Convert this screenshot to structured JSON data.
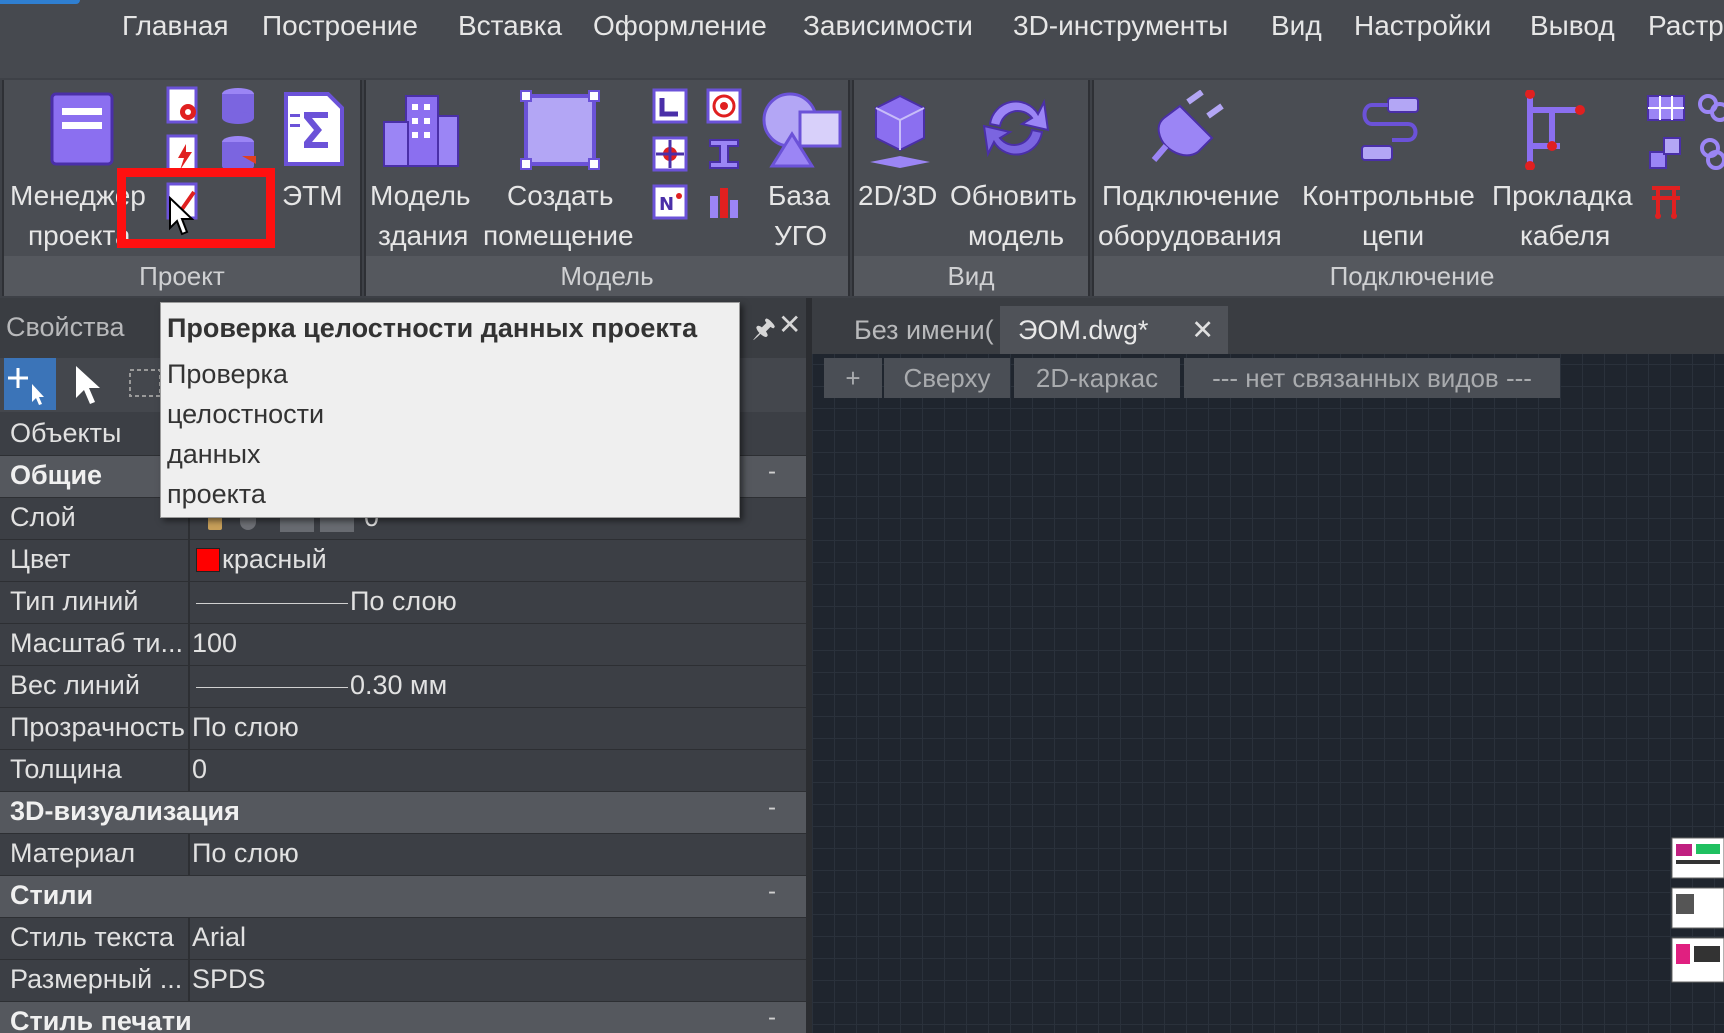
{
  "menu": {
    "items": [
      "Главная",
      "Построение",
      "Вставка",
      "Оформление",
      "Зависимости",
      "3D-инструменты",
      "Вид",
      "Настройки",
      "Вывод",
      "Растр"
    ]
  },
  "ribbon": {
    "panels": {
      "project": "Проект",
      "model": "Модель",
      "view": "Вид",
      "connection": "Подключение"
    },
    "buttons": {
      "manager_line1": "Менеджер",
      "manager_line2": "проекта",
      "etm": "ЭТМ",
      "building_line1": "Модель",
      "building_line2": "здания",
      "room_line1": "Создать",
      "room_line2": "помещение",
      "ugo_line1": "База",
      "ugo_line2": "УГО",
      "view2d3d": "2D/3D",
      "refresh_line1": "Обновить",
      "refresh_line2": "модель",
      "equip_line1": "Подключение",
      "equip_line2": "оборудования",
      "control_line1": "Контрольные",
      "control_line2": "цепи",
      "cable_line1": "Прокладка",
      "cable_line2": "кабеля"
    }
  },
  "properties": {
    "title": "Свойства",
    "objects_label": "Объекты",
    "sections": {
      "general": "Общие",
      "viz3d": "3D-визуализация",
      "styles": "Стили",
      "print_style": "Стиль печати"
    },
    "collapse": "-",
    "rows": {
      "layer": {
        "k": "Слой",
        "v": "0"
      },
      "color": {
        "k": "Цвет",
        "v": "красный",
        "swatch": "#ff0000"
      },
      "linetype": {
        "k": "Тип линий",
        "v": "По слою"
      },
      "ltscale": {
        "k": "Масштаб ти...",
        "v": "100"
      },
      "lineweight": {
        "k": "Вес линий",
        "v": "0.30 мм"
      },
      "transparency": {
        "k": "Прозрачность",
        "v": "По слою"
      },
      "thickness": {
        "k": "Толщина",
        "v": "0"
      },
      "material": {
        "k": "Материал",
        "v": "По слою"
      },
      "textstyle": {
        "k": "Стиль текста",
        "v": "Arial"
      },
      "dimstyle": {
        "k": "Размерный ...",
        "v": "SPDS"
      }
    }
  },
  "tooltip": {
    "title": "Проверка целостности данных проекта",
    "lines": [
      "Проверка",
      "целостности",
      "данных",
      "проекта"
    ]
  },
  "tabs": {
    "untitled": "Без имени(",
    "eom": "ЭОМ.dwg*",
    "close": "✕"
  },
  "viewbar": {
    "plus": "+",
    "top": "Сверху",
    "wire": "2D-каркас",
    "linked": "--- нет связанных видов ---"
  },
  "colors": {
    "accent_purple": "#7b68ee",
    "highlight_red": "#ff1010"
  }
}
